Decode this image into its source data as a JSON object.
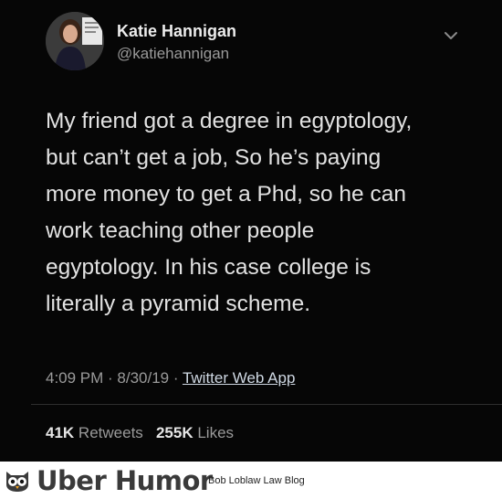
{
  "tweet": {
    "name": "Katie Hannigan",
    "handle": "@katiehannigan",
    "text": "My friend got a degree in egyptology,\nbut can’t get a job, So he’s paying\nmore money to get a Phd, so he can\nwork teaching other people\negyptology.  In his case college is\nliterally a pyramid scheme.",
    "time": "4:09 PM · 8/30/19 · ",
    "app": "Twitter Web App",
    "retweets_count": "41K",
    "retweets_label": "Retweets",
    "likes_count": "255K",
    "likes_label": "Likes"
  },
  "footer": {
    "brand": "Uber Humor",
    "blog": "Bob Loblaw Law Blog"
  },
  "icons": {
    "chevron": "chevron-down-icon",
    "logo": "owl-logo-icon"
  },
  "colors": {
    "background": "#060606",
    "text": "#e2e2e2",
    "muted": "#9a9a9a"
  }
}
